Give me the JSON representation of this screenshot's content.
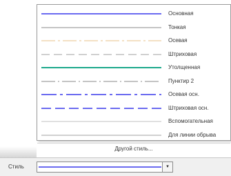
{
  "line_styles": [
    {
      "label": "Основная",
      "color": "#6a6af0",
      "dash": "",
      "stroke": 2
    },
    {
      "label": "Тонкая",
      "color": "#8a8a8a",
      "dash": "",
      "stroke": 1
    },
    {
      "label": "Осевая",
      "color": "#e8c08a",
      "dash": "20 4 3 4",
      "stroke": 1
    },
    {
      "label": "Штриховая",
      "color": "#a0a0a0",
      "dash": "12 6",
      "stroke": 1
    },
    {
      "label": "Утолщенная",
      "color": "#1aa88a",
      "dash": "",
      "stroke": 2
    },
    {
      "label": "Пунктир 2",
      "color": "#8a8a8a",
      "dash": "20 4 2 4",
      "stroke": 1
    },
    {
      "label": "Осевая осн.",
      "color": "#6a6af0",
      "dash": "22 5 4 5",
      "stroke": 2
    },
    {
      "label": "Штриховая осн.",
      "color": "#6a6af0",
      "dash": "14 6",
      "stroke": 2
    },
    {
      "label": "Вспомогательная",
      "color": "#c0c0c0",
      "dash": "",
      "stroke": 1
    },
    {
      "label": "Для линии обрыва",
      "color": "#a0a0a0",
      "dash": "",
      "stroke": 1
    }
  ],
  "other_style_label": "Другой стиль...",
  "style_field": {
    "label": "Стиль",
    "selected_color": "#6a6af0"
  },
  "combo_arrow": "▾"
}
